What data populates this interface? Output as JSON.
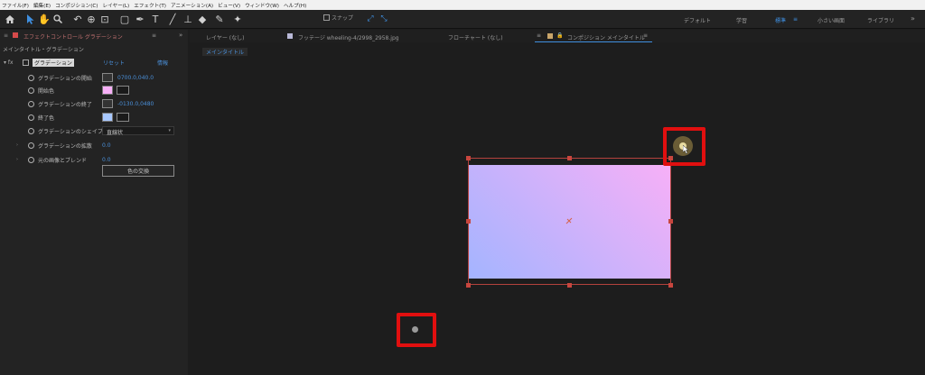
{
  "menu": [
    "ファイル(F)",
    "編集(E)",
    "コンポジション(C)",
    "レイヤー(L)",
    "エフェクト(T)",
    "アニメーション(A)",
    "ビュー(V)",
    "ウィンドウ(W)",
    "ヘルプ(H)"
  ],
  "toolbar": {
    "snap_label": "スナップ",
    "workspaces": [
      "デフォルト",
      "学習",
      "標準",
      "小さい画面",
      "ライブラリ"
    ],
    "active_workspace": "標準"
  },
  "effect_controls": {
    "tab_title": "エフェクトコントロール グラデーション",
    "subheader": "メインタイトル・グラデーション",
    "effect_name": "グラデーション",
    "reset_label": "リセット",
    "about_label": "情報",
    "properties": [
      {
        "label": "グラデーションの開始",
        "value": "0700.0,040.0"
      },
      {
        "label": "開始色",
        "swatch": "#f8b0f8"
      },
      {
        "label": "グラデーションの終了",
        "value": "-0130.0,0480"
      },
      {
        "label": "終了色",
        "swatch": "#a8c8ff"
      },
      {
        "label": "グラデーションのシェイプ",
        "value": "直線状"
      },
      {
        "label": "グラデーションの拡散",
        "value": "0.0"
      },
      {
        "label": "元の画像とブレンド",
        "value": "0.0"
      }
    ],
    "swap_button": "色の交換"
  },
  "viewer": {
    "tabs": [
      "レイヤー (なし)",
      "フッテージ wheeling-4/2998_2958.jpg",
      "フローチャート (なし)",
      "コンポジション メインタイトル"
    ],
    "comp_subtab": "メインタイトル"
  },
  "colors": {
    "highlight": "#e10f0f",
    "gradient_start": "#f7b0f7",
    "gradient_end": "#a4b4ff",
    "handle": "#c8463e",
    "accent": "#3f8fe0"
  }
}
